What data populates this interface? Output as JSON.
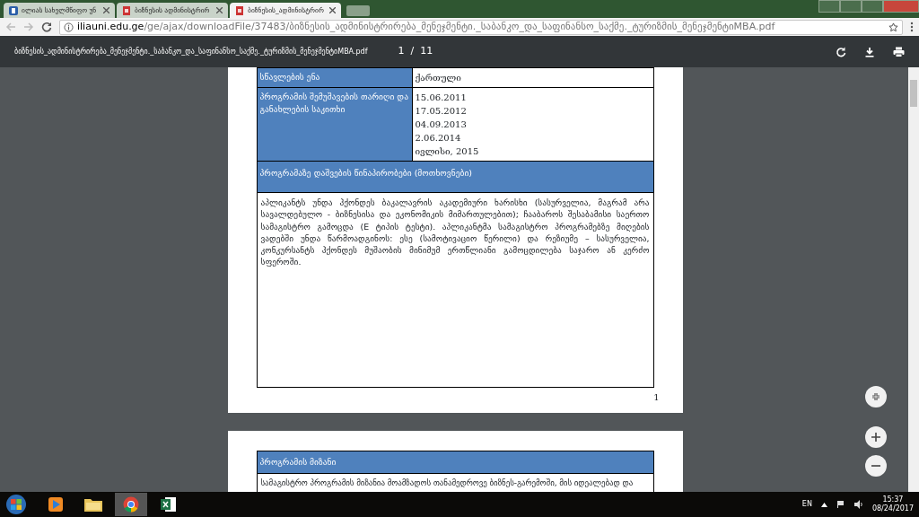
{
  "browser": {
    "tabs": [
      {
        "title": "ილიას სახელმწიფო უნ",
        "selected": false
      },
      {
        "title": "ბიზნესის ადმინისტრირ",
        "selected": false
      },
      {
        "title": "ბიზნესის_ადმინისტრირ",
        "selected": true
      }
    ],
    "url_host": "iliauni.edu.ge",
    "url_path": "/ge/ajax/downloadFile/37483/ბიზნესის_ადმინისტრირება_მენეჯმენტი._საბანკო_და_საფინანსო_საქმე._ტურიზმის_მენეჯმენტიMBA.pdf"
  },
  "pdf_toolbar": {
    "filename": "ბიზნესის_ადმინისტრირება_მენეჯმენტი._საბანკო_და_საფინანსო_საქმე._ტურიზმის_მენეჯმენტიMBA.pdf",
    "page_indicator": "1  /  11"
  },
  "page_1": {
    "rows": [
      {
        "label": "სწავლების ენა",
        "values": [
          "ქართული"
        ]
      },
      {
        "label": "პროგრამის შემუშავების თარიღი და განახლების საკითხი",
        "values": [
          "15.06.2011",
          "17.05.2012",
          "04.09.2013",
          "2.06.2014",
          "ივლისი, 2015"
        ]
      }
    ],
    "section_heading": "პროგრამაზე დაშვების წინაპირობები (მოთხოვნები)",
    "section_text": "აპლიკანტს უნდა ჰქონდეს ბაკალავრის აკადემიური ხარისხი (სასურველია, მაგრამ არა სავალდებულო - ბიზნესისა და ეკონომიკის მიმართულებით); ჩააბაროს შესაბამისი საერთო სამაგისტრო გამოცდა (E ტიპის ტესტი). აპლიკანტმა სამაგისტრო პროგრამებზე მიღების ვადებში უნდა წარმოადგინოს: ესე (სამოტივაციო წერილი) და რეზიუმე – სასურველია, კონკურსანტს ჰქონდეს მუშაობის მინიმუმ ერთწლიანი გამოცდილება საჯარო ან კერძო სფეროში.",
    "page_number": "1"
  },
  "page_2": {
    "section_heading": "პროგრამის მიზანი",
    "section_text": "სამაგისტრო პროგრამის მიზანია მოამზადოს თანამედროვე ბიზნეს-გარემოში, მის იდეალებად და"
  },
  "taskbar": {
    "apps": [
      {
        "kind": "media",
        "selected": false
      },
      {
        "kind": "folder",
        "selected": false
      },
      {
        "kind": "browser",
        "selected": true
      },
      {
        "kind": "spreadsheet",
        "selected": false
      }
    ],
    "language": "EN",
    "time": "15:37",
    "date": "08/24/2017"
  }
}
